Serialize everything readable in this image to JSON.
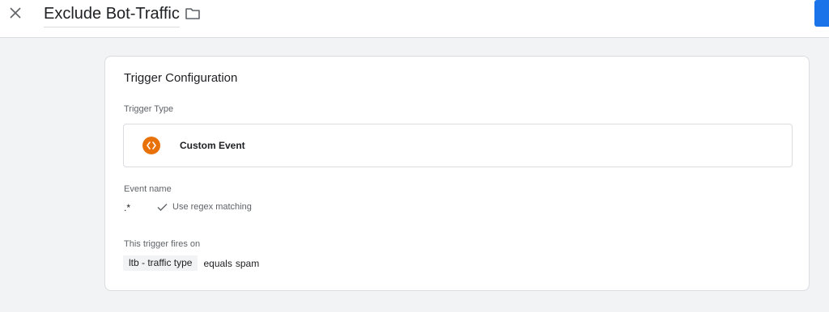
{
  "header": {
    "title": "Exclude Bot-Traffic"
  },
  "trigger_configuration": {
    "heading": "Trigger Configuration",
    "trigger_type_label": "Trigger Type",
    "trigger_type_value": "Custom Event",
    "trigger_type_icon": "code-brackets-icon",
    "event_name_label": "Event name",
    "event_name_value": ".*",
    "regex_label": "Use regex matching",
    "fires_on_label": "This trigger fires on",
    "condition": {
      "variable": "ltb - traffic type",
      "operator": "equals",
      "value": "spam"
    }
  },
  "colors": {
    "accent": "#1a73e8",
    "event_icon": "#e8710a"
  }
}
